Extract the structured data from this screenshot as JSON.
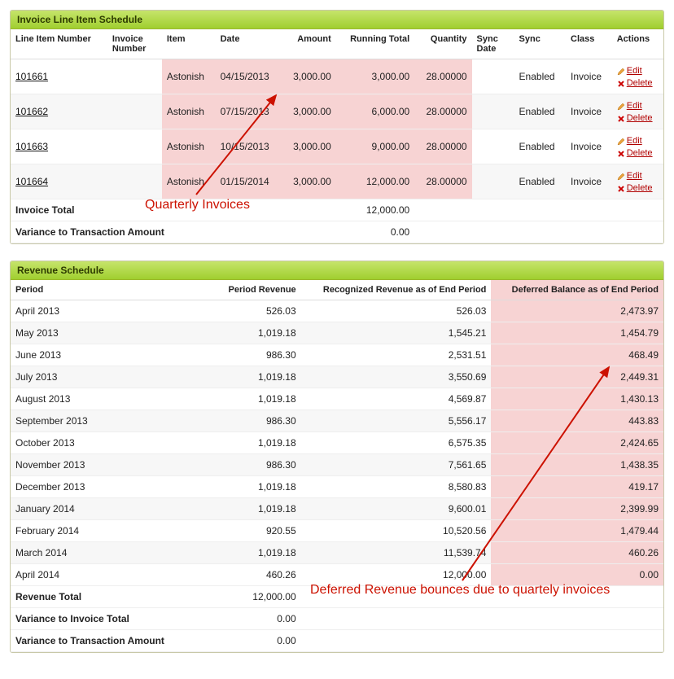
{
  "colors": {
    "highlight": "#f7d3d3",
    "annotation": "#cc1100"
  },
  "invoice_panel": {
    "title": "Invoice Line Item Schedule",
    "columns": {
      "line_item_number": "Line Item Number",
      "invoice_number": "Invoice Number",
      "item": "Item",
      "date": "Date",
      "amount": "Amount",
      "running_total": "Running Total",
      "quantity": "Quantity",
      "sync_date": "Sync Date",
      "sync": "Sync",
      "class": "Class",
      "actions": "Actions"
    },
    "rows": [
      {
        "line_item_number": "101661",
        "invoice_number": "",
        "item": "Astonish",
        "date": "04/15/2013",
        "amount": "3,000.00",
        "running_total": "3,000.00",
        "quantity": "28.00000",
        "sync_date": "",
        "sync": "Enabled",
        "class": "Invoice"
      },
      {
        "line_item_number": "101662",
        "invoice_number": "",
        "item": "Astonish",
        "date": "07/15/2013",
        "amount": "3,000.00",
        "running_total": "6,000.00",
        "quantity": "28.00000",
        "sync_date": "",
        "sync": "Enabled",
        "class": "Invoice"
      },
      {
        "line_item_number": "101663",
        "invoice_number": "",
        "item": "Astonish",
        "date": "10/15/2013",
        "amount": "3,000.00",
        "running_total": "9,000.00",
        "quantity": "28.00000",
        "sync_date": "",
        "sync": "Enabled",
        "class": "Invoice"
      },
      {
        "line_item_number": "101664",
        "invoice_number": "",
        "item": "Astonish",
        "date": "01/15/2014",
        "amount": "3,000.00",
        "running_total": "12,000.00",
        "quantity": "28.00000",
        "sync_date": "",
        "sync": "Enabled",
        "class": "Invoice"
      }
    ],
    "totals": {
      "invoice_total_label": "Invoice Total",
      "invoice_total_value": "12,000.00",
      "variance_label": "Variance to Transaction Amount",
      "variance_value": "0.00"
    },
    "action_labels": {
      "edit": "Edit",
      "delete": "Delete"
    },
    "annotation": "Quarterly Invoices"
  },
  "revenue_panel": {
    "title": "Revenue Schedule",
    "columns": {
      "period": "Period",
      "period_revenue": "Period Revenue",
      "recognized": "Recognized Revenue as of End Period",
      "deferred": "Deferred Balance as of End Period"
    },
    "rows": [
      {
        "period": "April 2013",
        "period_revenue": "526.03",
        "recognized": "526.03",
        "deferred": "2,473.97"
      },
      {
        "period": "May 2013",
        "period_revenue": "1,019.18",
        "recognized": "1,545.21",
        "deferred": "1,454.79"
      },
      {
        "period": "June 2013",
        "period_revenue": "986.30",
        "recognized": "2,531.51",
        "deferred": "468.49"
      },
      {
        "period": "July 2013",
        "period_revenue": "1,019.18",
        "recognized": "3,550.69",
        "deferred": "2,449.31"
      },
      {
        "period": "August 2013",
        "period_revenue": "1,019.18",
        "recognized": "4,569.87",
        "deferred": "1,430.13"
      },
      {
        "period": "September 2013",
        "period_revenue": "986.30",
        "recognized": "5,556.17",
        "deferred": "443.83"
      },
      {
        "period": "October 2013",
        "period_revenue": "1,019.18",
        "recognized": "6,575.35",
        "deferred": "2,424.65"
      },
      {
        "period": "November 2013",
        "period_revenue": "986.30",
        "recognized": "7,561.65",
        "deferred": "1,438.35"
      },
      {
        "period": "December 2013",
        "period_revenue": "1,019.18",
        "recognized": "8,580.83",
        "deferred": "419.17"
      },
      {
        "period": "January 2014",
        "period_revenue": "1,019.18",
        "recognized": "9,600.01",
        "deferred": "2,399.99"
      },
      {
        "period": "February 2014",
        "period_revenue": "920.55",
        "recognized": "10,520.56",
        "deferred": "1,479.44"
      },
      {
        "period": "March 2014",
        "period_revenue": "1,019.18",
        "recognized": "11,539.74",
        "deferred": "460.26"
      },
      {
        "period": "April 2014",
        "period_revenue": "460.26",
        "recognized": "12,000.00",
        "deferred": "0.00"
      }
    ],
    "totals": {
      "revenue_total_label": "Revenue Total",
      "revenue_total_value": "12,000.00",
      "variance_invoice_label": "Variance to Invoice Total",
      "variance_invoice_value": "0.00",
      "variance_txn_label": "Variance to Transaction Amount",
      "variance_txn_value": "0.00"
    },
    "annotation": "Deferred Revenue bounces due to quartely invoices"
  }
}
